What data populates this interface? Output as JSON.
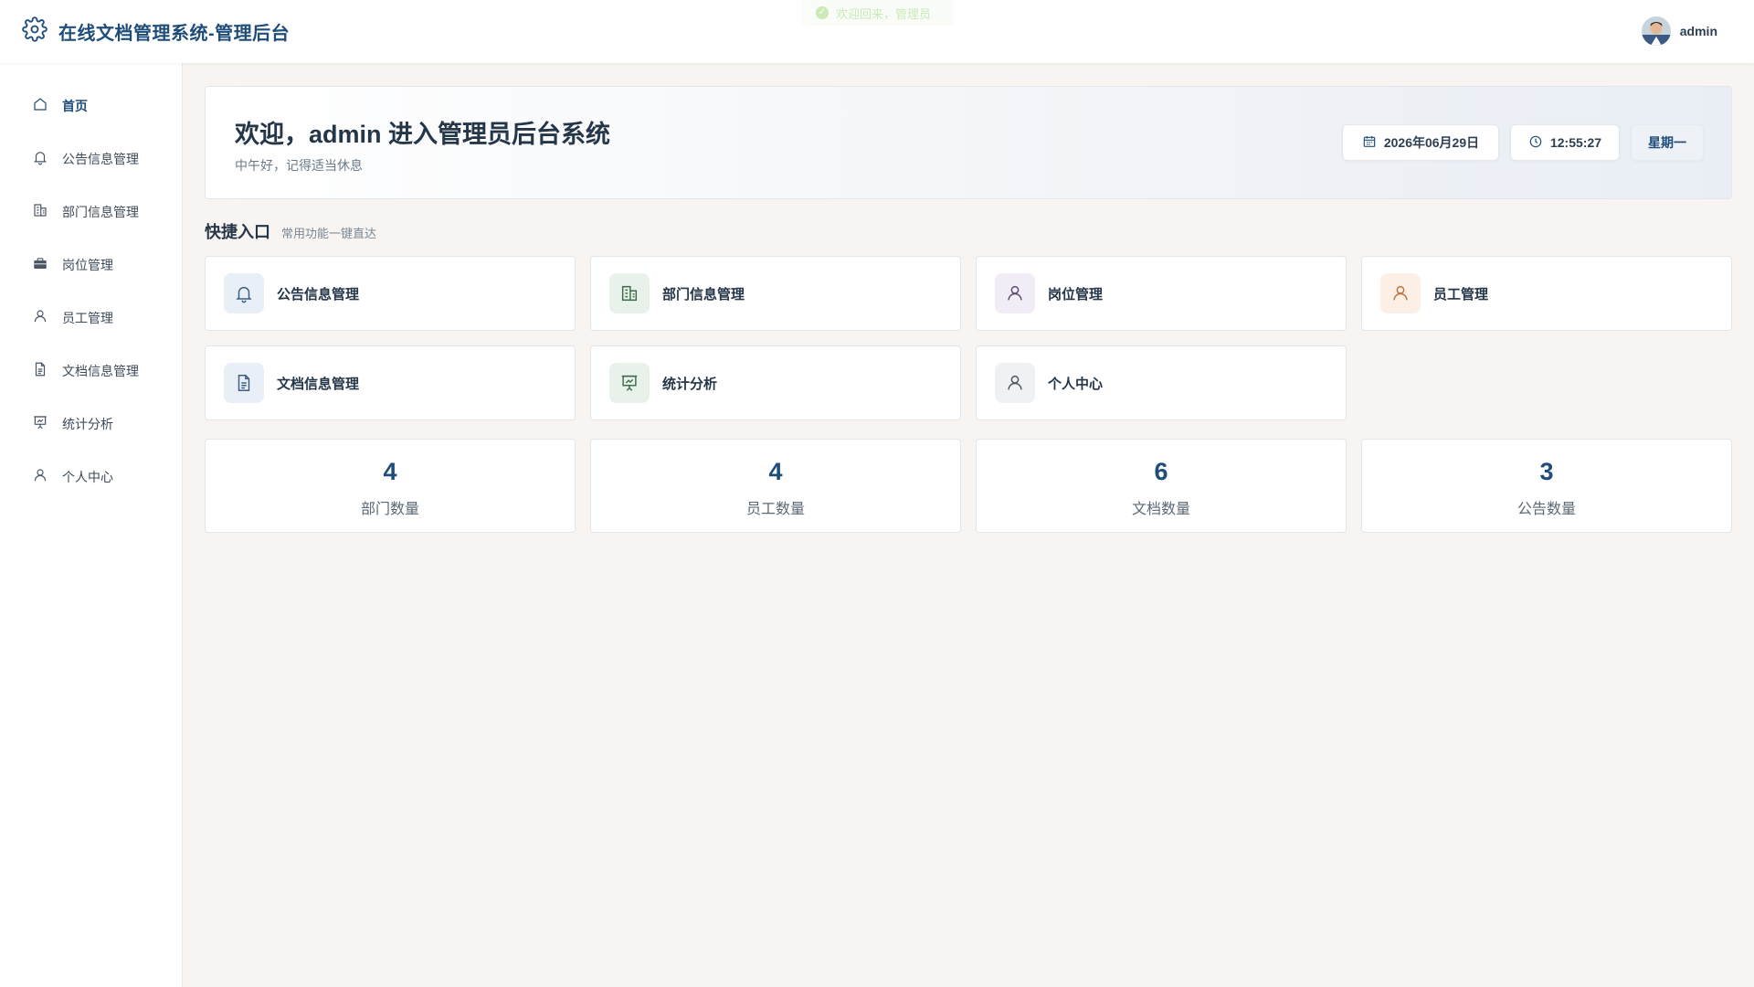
{
  "header": {
    "title": "在线文档管理系统-管理后台",
    "toast": "欢迎回来，管理员",
    "username": "admin"
  },
  "sidebar": {
    "items": [
      {
        "label": "首页",
        "icon": "home-icon",
        "active": true
      },
      {
        "label": "公告信息管理",
        "icon": "bell-icon"
      },
      {
        "label": "部门信息管理",
        "icon": "building-icon"
      },
      {
        "label": "岗位管理",
        "icon": "briefcase-icon"
      },
      {
        "label": "员工管理",
        "icon": "user-icon"
      },
      {
        "label": "文档信息管理",
        "icon": "document-icon"
      },
      {
        "label": "统计分析",
        "icon": "presentation-chart-icon"
      },
      {
        "label": "个人中心",
        "icon": "user-icon"
      }
    ]
  },
  "welcome": {
    "title": "欢迎，admin 进入管理员后台系统",
    "subtitle": "中午好，记得适当休息",
    "date": "2026年06月29日",
    "time": "12:55:27",
    "weekday": "星期一"
  },
  "quick": {
    "title": "快捷入口",
    "subtitle": "常用功能一键直达",
    "cards": [
      {
        "label": "公告信息管理",
        "icon": "bell-icon"
      },
      {
        "label": "部门信息管理",
        "icon": "building-icon"
      },
      {
        "label": "岗位管理",
        "icon": "user-icon"
      },
      {
        "label": "员工管理",
        "icon": "user-icon"
      },
      {
        "label": "文档信息管理",
        "icon": "document-icon"
      },
      {
        "label": "统计分析",
        "icon": "presentation-chart-icon"
      },
      {
        "label": "个人中心",
        "icon": "user-icon"
      }
    ]
  },
  "stats": [
    {
      "value": "4",
      "label": "部门数量"
    },
    {
      "value": "4",
      "label": "员工数量"
    },
    {
      "value": "6",
      "label": "文档数量"
    },
    {
      "value": "3",
      "label": "公告数量"
    }
  ],
  "colors": {
    "brand": "#1f4d7a",
    "background": "#f7f4f1",
    "toast_green": "#67c23a"
  }
}
